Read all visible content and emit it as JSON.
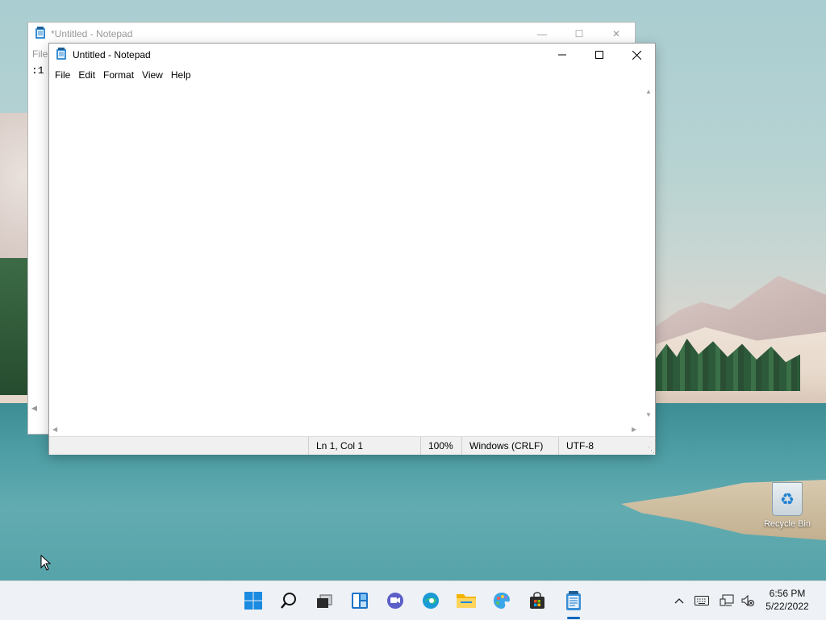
{
  "back_window": {
    "title": "*Untitled - Notepad",
    "menu_first": "File",
    "text_fragment": ":1"
  },
  "front_window": {
    "title": "Untitled - Notepad",
    "menu": [
      "File",
      "Edit",
      "Format",
      "View",
      "Help"
    ],
    "editor_text": "",
    "status": {
      "position": "Ln 1, Col 1",
      "zoom": "100%",
      "line_ending": "Windows (CRLF)",
      "encoding": "UTF-8"
    }
  },
  "desktop": {
    "recycle_bin_label": "Recycle Bin"
  },
  "taskbar": {
    "icons": [
      "start-icon",
      "search-icon",
      "task-view-icon",
      "widgets-icon",
      "chat-icon",
      "edge-icon",
      "file-explorer-icon",
      "photos-icon",
      "store-icon",
      "notepad-icon"
    ],
    "clock_time": "6:56 PM",
    "clock_date": "5/22/2022"
  },
  "colors": {
    "accent": "#0067c0",
    "taskbar_bg": "#eef1f5",
    "status_bar_bg": "#f0f0f0"
  }
}
